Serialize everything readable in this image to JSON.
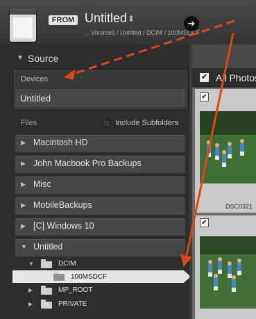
{
  "header": {
    "from_badge": "FROM",
    "device_title": "Untitled",
    "title_chevron": "⬍",
    "path": "…Volumes / Untitled / DCIM / 100MSDCF",
    "go_arrow": "➔"
  },
  "source_panel": {
    "title": "Source",
    "devices_label": "Devices",
    "device_item": "Untitled",
    "files_label": "Files",
    "include_subfolders_label": "Include Subfolders",
    "volumes": [
      {
        "label": "Macintosh HD",
        "expanded": false
      },
      {
        "label": "John Macbook Pro Backups",
        "expanded": false
      },
      {
        "label": "Misc",
        "expanded": false
      },
      {
        "label": "MobileBackups",
        "expanded": false
      },
      {
        "label": "[C] Windows 10",
        "expanded": false
      },
      {
        "label": "Untitled",
        "expanded": true
      }
    ],
    "folders": [
      {
        "label": "DCIM",
        "expanded": true
      },
      {
        "label": "100MSDCF",
        "selected": true
      },
      {
        "label": "MP_ROOT",
        "expanded": false
      },
      {
        "label": "PRIVATE",
        "expanded": false
      }
    ]
  },
  "grid": {
    "all_photos_label": "All Photos",
    "photos": [
      {
        "file_name": "DSC0321",
        "checked": true
      },
      {
        "file_name": "",
        "checked": true
      }
    ]
  },
  "icons": {
    "triangle_right": "▶",
    "triangle_down": "▼",
    "check": "✔"
  },
  "colors": {
    "annotation_arrow": "#e0461c",
    "selection": "#e6e6e6",
    "panel": "#2e2e2e"
  }
}
